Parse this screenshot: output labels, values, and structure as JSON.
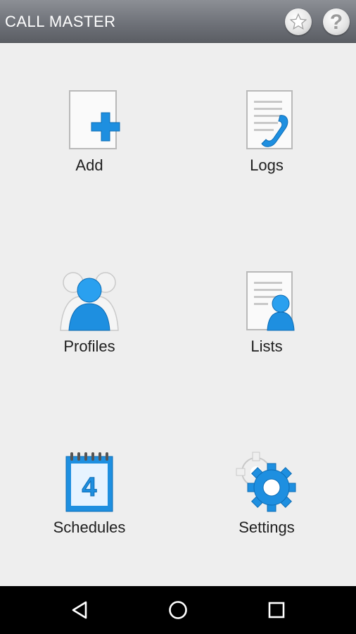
{
  "app": {
    "title": "CALL MASTER",
    "star_icon": "star-icon",
    "help_icon": "help-icon",
    "help_glyph": "?"
  },
  "menu": {
    "add_label": "Add",
    "logs_label": "Logs",
    "profiles_label": "Profiles",
    "lists_label": "Lists",
    "schedules_label": "Schedules",
    "settings_label": "Settings",
    "calendar_day": "4"
  },
  "navbar": {
    "back_icon": "back-icon",
    "home_icon": "home-icon",
    "recents_icon": "recents-icon"
  },
  "colors": {
    "accent_blue": "#1e8fe0",
    "appbar": "#6f7279",
    "background": "#eeeeee"
  }
}
